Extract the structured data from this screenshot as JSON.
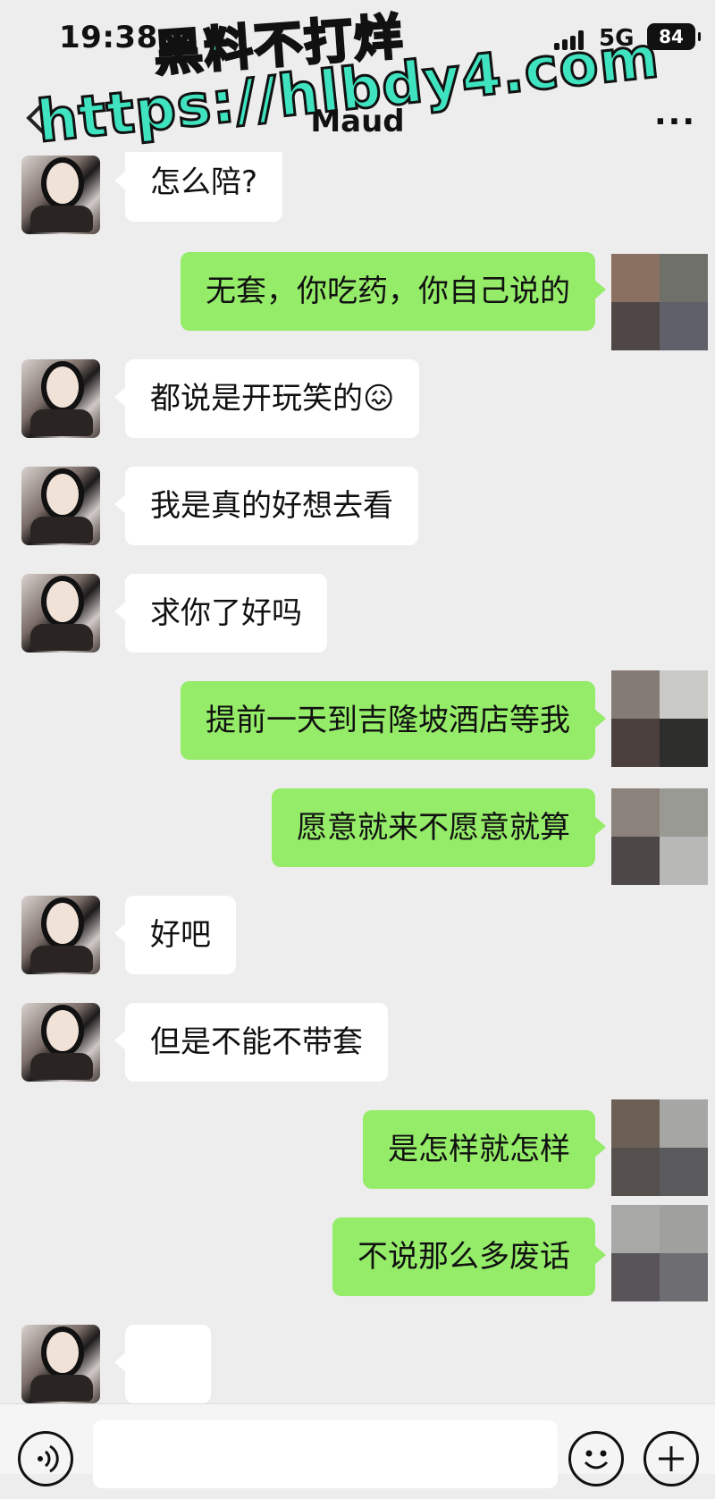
{
  "status": {
    "time": "19:38",
    "network": "5G",
    "battery": "84"
  },
  "nav": {
    "title": "Maud"
  },
  "watermark": {
    "line1": "黑料不打烊",
    "line2": "https://hlbdy4.com"
  },
  "colors": {
    "incoming_bubble": "#ffffff",
    "outgoing_bubble": "#95ec69",
    "background": "#ededed"
  },
  "messages": [
    {
      "side": "in",
      "text": "怎么陪?"
    },
    {
      "side": "out",
      "text": "无套，你吃药，你自己说的"
    },
    {
      "side": "in",
      "text": "都说是开玩笑的😖"
    },
    {
      "side": "in",
      "text": "我是真的好想去看"
    },
    {
      "side": "in",
      "text": "求你了好吗"
    },
    {
      "side": "out",
      "text": "提前一天到吉隆坡酒店等我"
    },
    {
      "side": "out",
      "text": "愿意就来不愿意就算"
    },
    {
      "side": "in",
      "text": "好吧"
    },
    {
      "side": "in",
      "text": "但是不能不带套"
    },
    {
      "side": "out",
      "text": "是怎样就怎样"
    },
    {
      "side": "out",
      "text": "不说那么多废话"
    }
  ],
  "composer": {
    "voice_icon": "voice-icon",
    "emoji_icon": "emoji-icon",
    "plus_icon": "plus-icon"
  }
}
